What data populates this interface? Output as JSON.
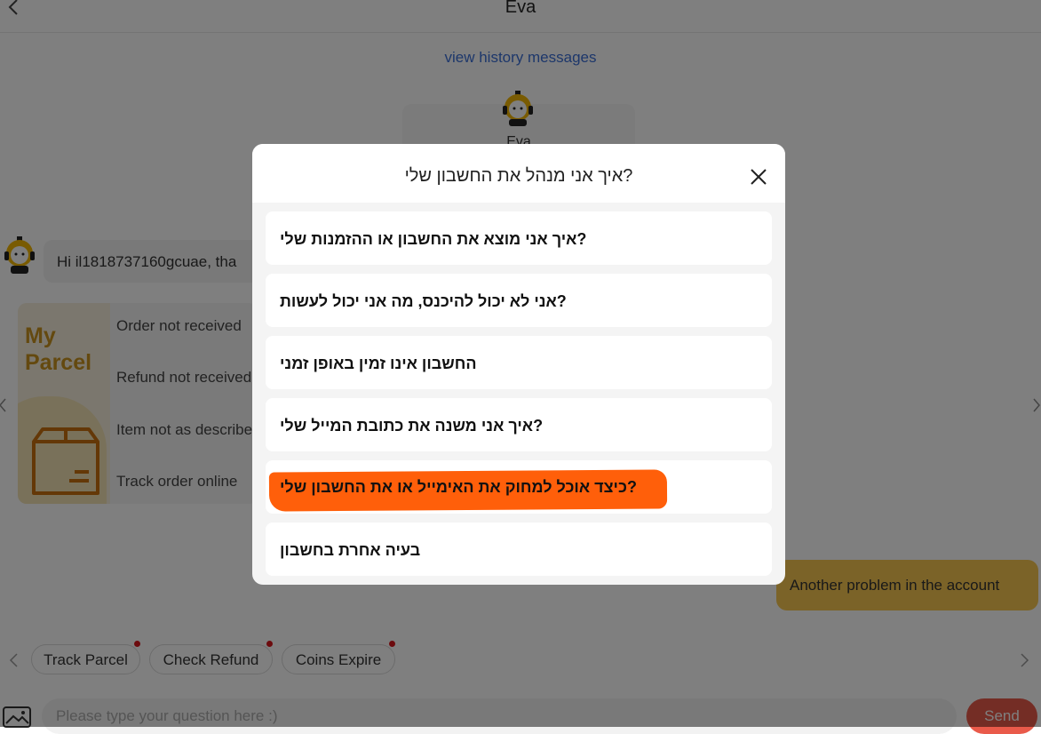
{
  "header": {
    "title": "Eva"
  },
  "chat": {
    "history_link": "view history messages",
    "bot_name": "Eva",
    "greeting": "Hi il1818737160gcuae, tha",
    "parcel_label": "My Parcel",
    "parcel_links": [
      "Order not received",
      "Refund not received",
      "Item not as described",
      "Track order online"
    ],
    "user_message": "Another problem in the account"
  },
  "chips": [
    "Track Parcel",
    "Check Refund",
    "Coins Expire"
  ],
  "input": {
    "placeholder": "Please type your question here :)",
    "send_label": "Send"
  },
  "modal": {
    "title": "?איך אני מנהל את החשבון שלי",
    "options": [
      "?איך אני מוצא את החשבון או ההזמנות שלי",
      "?אני לא יכול להיכנס, מה אני יכול לעשות",
      "החשבון אינו זמין באופן זמני",
      "?איך אני משנה את כתובת המייל שלי",
      "?כיצד אוכל למחוק את האימייל או את החשבון שלי",
      "בעיה אחרת בחשבון"
    ]
  },
  "colors": {
    "accent_orange": "#ff5f0a",
    "user_bubble": "#f7c650",
    "link_blue": "#3b6fd6",
    "send": "#e95a4a"
  }
}
